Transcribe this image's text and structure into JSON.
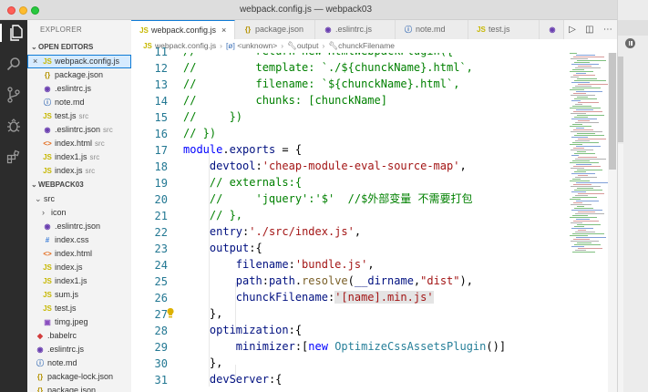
{
  "window": {
    "title": "webpack.config.js — webpack03"
  },
  "sidebar": {
    "title": "EXPLORER",
    "open_editors_title": "OPEN EDITORS",
    "open_editors": [
      {
        "name": "webpack.config.js",
        "icon": "js-file-icon",
        "kind": "js",
        "selected": true,
        "close": "×",
        "folder": ""
      },
      {
        "name": "package.json",
        "icon": "json-file-icon",
        "kind": "json",
        "folder": ""
      },
      {
        "name": ".eslintrc.js",
        "icon": "eslint-file-icon",
        "kind": "es",
        "folder": ""
      },
      {
        "name": "note.md",
        "icon": "markdown-file-icon",
        "kind": "md",
        "folder": ""
      },
      {
        "name": "test.js",
        "icon": "js-file-icon",
        "kind": "js",
        "folder": "src"
      },
      {
        "name": ".eslintrc.json",
        "icon": "eslint-file-icon",
        "kind": "es",
        "folder": "src"
      },
      {
        "name": "index.html",
        "icon": "html-file-icon",
        "kind": "html",
        "folder": "src"
      },
      {
        "name": "index1.js",
        "icon": "js-file-icon",
        "kind": "js",
        "folder": "src"
      },
      {
        "name": "index.js",
        "icon": "js-file-icon",
        "kind": "js",
        "folder": "src"
      }
    ],
    "project_title": "WEBPACK03",
    "tree": [
      {
        "name": "src",
        "type": "folder",
        "indent": 1
      },
      {
        "name": "icon",
        "type": "folder-collapsed",
        "indent": 2
      },
      {
        "name": ".eslintrc.json",
        "icon": "eslint-file-icon",
        "kind": "es",
        "indent": 2
      },
      {
        "name": "index.css",
        "icon": "css-file-icon",
        "kind": "css",
        "indent": 2
      },
      {
        "name": "index.html",
        "icon": "html-file-icon",
        "kind": "html",
        "indent": 2
      },
      {
        "name": "index.js",
        "icon": "js-file-icon",
        "kind": "js",
        "indent": 2
      },
      {
        "name": "index1.js",
        "icon": "js-file-icon",
        "kind": "js",
        "indent": 2
      },
      {
        "name": "sum.js",
        "icon": "js-file-icon",
        "kind": "js",
        "indent": 2
      },
      {
        "name": "test.js",
        "icon": "js-file-icon",
        "kind": "js",
        "indent": 2
      },
      {
        "name": "timg.jpeg",
        "icon": "image-file-icon",
        "kind": "img",
        "indent": 2
      },
      {
        "name": ".babelrc",
        "icon": "babel-file-icon",
        "kind": "dot",
        "indent": 1
      },
      {
        "name": ".eslintrc.js",
        "icon": "eslint-file-icon",
        "kind": "es",
        "indent": 1
      },
      {
        "name": "note.md",
        "icon": "markdown-file-icon",
        "kind": "md",
        "indent": 1
      },
      {
        "name": "package-lock.json",
        "icon": "json-file-icon",
        "kind": "json",
        "indent": 1
      },
      {
        "name": "package.json",
        "icon": "json-file-icon",
        "kind": "json",
        "indent": 1
      }
    ]
  },
  "tabs": [
    {
      "label": "webpack.config.js",
      "icon": "js-file-icon",
      "active": true,
      "close": "×"
    },
    {
      "label": "package.json",
      "icon": "json-file-icon"
    },
    {
      "label": ".eslintrc.js",
      "icon": "eslint-file-icon"
    },
    {
      "label": "note.md",
      "icon": "markdown-file-icon"
    },
    {
      "label": "test.js",
      "icon": "js-file-icon"
    }
  ],
  "breadcrumb": [
    "webpack.config.js",
    "<unknown>",
    "output",
    "chunckFilename"
  ],
  "code": {
    "lines": [
      {
        "n": "11",
        "tokens": [
          [
            "c-com",
            "//         return new HtmlWebpackPlugin({"
          ]
        ]
      },
      {
        "n": "12",
        "tokens": [
          [
            "c-com",
            "//         template: `./${chunckName}.html`,"
          ]
        ]
      },
      {
        "n": "13",
        "tokens": [
          [
            "c-com",
            "//         filename: `${chunckName}.html`,"
          ]
        ]
      },
      {
        "n": "14",
        "tokens": [
          [
            "c-com",
            "//         chunks: [chunckName]"
          ]
        ]
      },
      {
        "n": "15",
        "tokens": [
          [
            "c-com",
            "//     })"
          ]
        ]
      },
      {
        "n": "16",
        "tokens": [
          [
            "c-com",
            "// })"
          ]
        ]
      },
      {
        "n": "17",
        "tokens": [
          [
            "c-kw",
            "module"
          ],
          [
            "c-plain",
            "."
          ],
          [
            "c-prop",
            "exports"
          ],
          [
            "c-plain",
            " = {"
          ]
        ]
      },
      {
        "n": "18",
        "tokens": [
          [
            "c-plain",
            "    "
          ],
          [
            "c-prop",
            "devtool"
          ],
          [
            "c-plain",
            ":"
          ],
          [
            "c-str",
            "'cheap-module-eval-source-map'"
          ],
          [
            "c-plain",
            ","
          ]
        ]
      },
      {
        "n": "19",
        "tokens": [
          [
            "c-plain",
            "    "
          ],
          [
            "c-com",
            "// externals:{"
          ]
        ]
      },
      {
        "n": "20",
        "tokens": [
          [
            "c-plain",
            "    "
          ],
          [
            "c-com",
            "//     'jquery':'$'  //$外部变量 不需要打包"
          ]
        ]
      },
      {
        "n": "21",
        "tokens": [
          [
            "c-plain",
            "    "
          ],
          [
            "c-com",
            "// },"
          ]
        ]
      },
      {
        "n": "22",
        "tokens": [
          [
            "c-plain",
            "    "
          ],
          [
            "c-prop",
            "entry"
          ],
          [
            "c-plain",
            ":"
          ],
          [
            "c-str",
            "'./src/index.js'"
          ],
          [
            "c-plain",
            ","
          ]
        ]
      },
      {
        "n": "23",
        "tokens": [
          [
            "c-plain",
            "    "
          ],
          [
            "c-prop",
            "output"
          ],
          [
            "c-plain",
            ":{"
          ]
        ]
      },
      {
        "n": "24",
        "tokens": [
          [
            "c-plain",
            "        "
          ],
          [
            "c-prop",
            "filename"
          ],
          [
            "c-plain",
            ":"
          ],
          [
            "c-str",
            "'bundle.js'"
          ],
          [
            "c-plain",
            ","
          ]
        ]
      },
      {
        "n": "25",
        "tokens": [
          [
            "c-plain",
            "        "
          ],
          [
            "c-prop",
            "path"
          ],
          [
            "c-plain",
            ":"
          ],
          [
            "c-prop",
            "path"
          ],
          [
            "c-plain",
            "."
          ],
          [
            "c-fn",
            "resolve"
          ],
          [
            "c-plain",
            "("
          ],
          [
            "c-prop",
            "__dirname"
          ],
          [
            "c-plain",
            ","
          ],
          [
            "c-str",
            "\"dist\""
          ],
          [
            "c-plain",
            "),"
          ]
        ]
      },
      {
        "n": "26",
        "tokens": [
          [
            "c-plain",
            "        "
          ],
          [
            "c-prop",
            "chunckFilename"
          ],
          [
            "c-plain",
            ":"
          ],
          [
            "c-str",
            "'[name].min.js'"
          ]
        ]
      },
      {
        "n": "27",
        "tokens": [
          [
            "c-plain",
            "    },"
          ]
        ]
      },
      {
        "n": "28",
        "tokens": [
          [
            "c-plain",
            "    "
          ],
          [
            "c-prop",
            "optimization"
          ],
          [
            "c-plain",
            ":{"
          ]
        ]
      },
      {
        "n": "29",
        "tokens": [
          [
            "c-plain",
            "        "
          ],
          [
            "c-prop",
            "minimizer"
          ],
          [
            "c-plain",
            ":["
          ],
          [
            "c-kw",
            "new"
          ],
          [
            "c-plain",
            " "
          ],
          [
            "c-cls",
            "OptimizeCssAssetsPlugin"
          ],
          [
            "c-plain",
            "()]"
          ]
        ]
      },
      {
        "n": "30",
        "tokens": [
          [
            "c-plain",
            "    },"
          ]
        ]
      },
      {
        "n": "31",
        "tokens": [
          [
            "c-plain",
            "    "
          ],
          [
            "c-prop",
            "devServer"
          ],
          [
            "c-plain",
            ":{"
          ]
        ]
      }
    ]
  },
  "colors": {
    "accent": "#0f7bd6",
    "activity_bar": "#2c2c2c",
    "sidebar": "#f3f3f3",
    "selection": "#add6ff"
  }
}
